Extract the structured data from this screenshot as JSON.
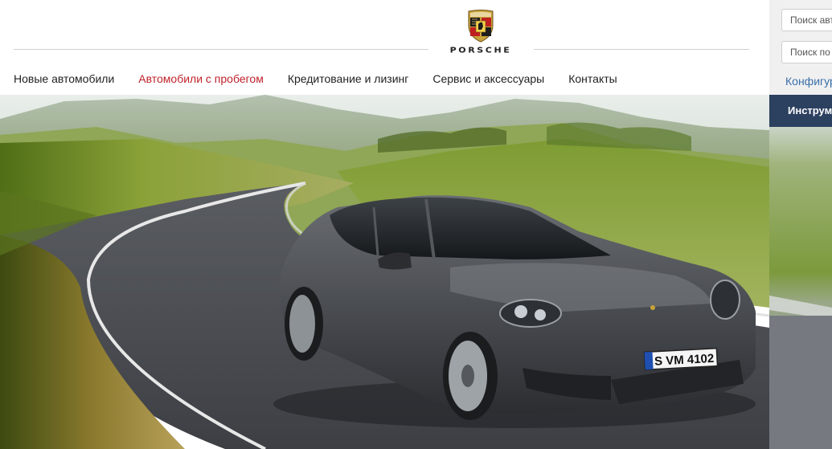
{
  "brand": {
    "wordmark": "PORSCHE"
  },
  "nav": {
    "items": [
      {
        "label": "Новые автомобили",
        "active": false
      },
      {
        "label": "Автомобили с пробегом",
        "active": true
      },
      {
        "label": "Кредитование и лизинг",
        "active": false
      },
      {
        "label": "Сервис и аксессуары",
        "active": false
      },
      {
        "label": "Контакты",
        "active": false
      }
    ],
    "active_color": "#c0232b"
  },
  "tools": {
    "search_vehicles_placeholder": "Поиск авто",
    "search_site_placeholder": "Поиск по",
    "configurator_label": "Конфигур",
    "tools_button_label": "Инструм",
    "button_color": "#2c4060",
    "link_color": "#3a6ea8"
  },
  "hero": {
    "license_plate": "S VM 4102"
  }
}
